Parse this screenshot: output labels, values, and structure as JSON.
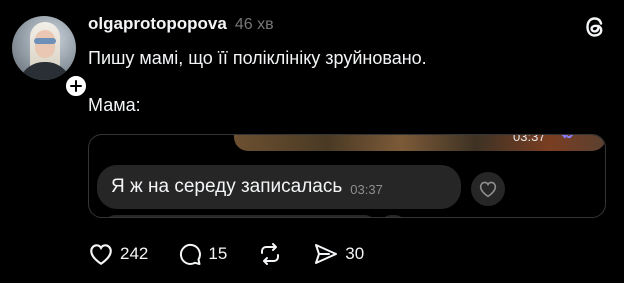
{
  "post": {
    "username": "olgaprotopopova",
    "time": "46 хв",
    "text_line1": "Пишу мамі, що її поліклініку зруйновано.",
    "text_line2": "Мама:"
  },
  "media": {
    "top_photo_time": "03:37",
    "message_text": "Я ж на середу записалась",
    "message_time": "03:37"
  },
  "actions": {
    "likes": "242",
    "comments": "15",
    "shares": "30"
  },
  "icons": {
    "avatar": "avatar-photo",
    "follow": "plus-icon",
    "logo": "threads-logo-icon",
    "like": "heart-icon",
    "comment": "comment-icon",
    "repost": "repost-icon",
    "share": "send-icon",
    "react": "heart-icon"
  },
  "colors": {
    "background": "#000000",
    "text": "#f3f5f7",
    "muted": "#777777",
    "bubble": "#262626",
    "border": "#333638"
  }
}
